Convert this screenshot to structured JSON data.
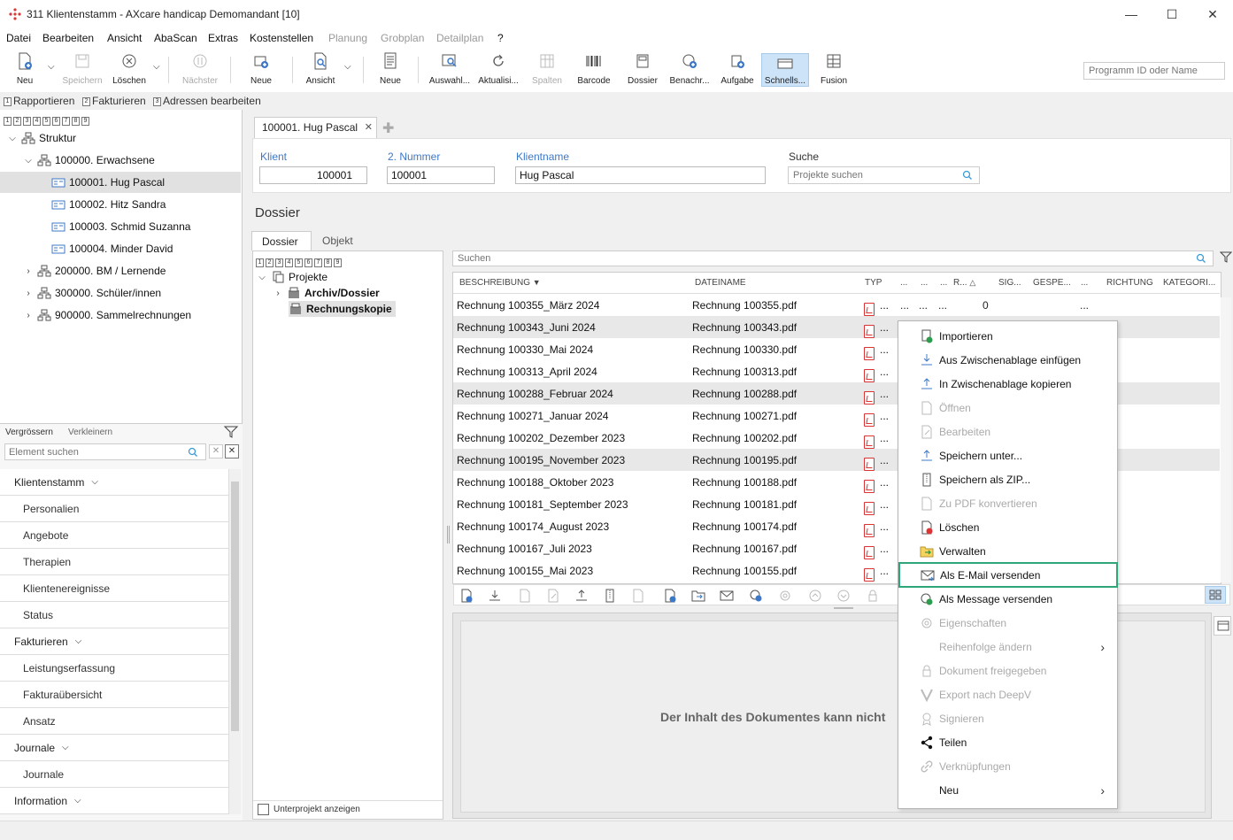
{
  "window": {
    "title": "311 Klientenstamm - AXcare handicap Demomandant [10]",
    "min": "—",
    "max": "☐",
    "close": "✕"
  },
  "menu": [
    {
      "label": "Datei",
      "enabled": true
    },
    {
      "label": "Bearbeiten",
      "enabled": true
    },
    {
      "label": "Ansicht",
      "enabled": true
    },
    {
      "label": "AbaScan",
      "enabled": true
    },
    {
      "label": "Extras",
      "enabled": true
    },
    {
      "label": "Kostenstellen",
      "enabled": true
    },
    {
      "label": "Planung",
      "enabled": false
    },
    {
      "label": "Grobplan",
      "enabled": false
    },
    {
      "label": "Detailplan",
      "enabled": false
    },
    {
      "label": "?",
      "enabled": true
    }
  ],
  "toolbar": {
    "neu": "Neu",
    "speichern": "Speichern",
    "loeschen": "Löschen",
    "naechster": "Nächster",
    "neue1": "Neue",
    "ansicht": "Ansicht",
    "neue2": "Neue",
    "auswahl": "Auswahl...",
    "aktualisieren": "Aktualisi...",
    "spalten": "Spalten",
    "barcode": "Barcode",
    "dossier": "Dossier",
    "benachrichtigung": "Benachr...",
    "aufgabe": "Aufgabe",
    "schnellsuche": "Schnells...",
    "fusion": "Fusion",
    "programm_id_placeholder": "Programm ID oder Name"
  },
  "quickbar": {
    "item1": "Rapportieren",
    "item2": "Fakturieren",
    "item3": "Adressen bearbeiten",
    "n1": "1",
    "n2": "2",
    "n3": "3"
  },
  "level_numbers": [
    "1",
    "2",
    "3",
    "4",
    "5",
    "6",
    "7",
    "8",
    "9"
  ],
  "tree": {
    "root": "Struktur",
    "items": [
      {
        "label": "100000. Erwachsene"
      },
      {
        "label": "100001. Hug Pascal"
      },
      {
        "label": "100002. Hitz Sandra"
      },
      {
        "label": "100003. Schmid Suzanna"
      },
      {
        "label": "100004. Minder David"
      },
      {
        "label": "200000. BM / Lernende"
      },
      {
        "label": "300000. Schüler/innen"
      },
      {
        "label": "900000. Sammelrechnungen"
      }
    ]
  },
  "navtools": {
    "vergroessern": "Vergrössern",
    "verkleinern": "Verkleinern",
    "search_placeholder": "Element suchen"
  },
  "nav": {
    "klientenstamm": "Klientenstamm",
    "personalien": "Personalien",
    "angebote": "Angebote",
    "therapien": "Therapien",
    "klientenereignisse": "Klientenereignisse",
    "status": "Status",
    "fakturieren": "Fakturieren",
    "leistungserfassung": "Leistungserfassung",
    "fakturauebersicht": "Fakturaübersicht",
    "ansatz": "Ansatz",
    "journale": "Journale",
    "journale_sub": "Journale",
    "information": "Information"
  },
  "tab": {
    "label": "100001. Hug Pascal"
  },
  "header": {
    "klient_label": "Klient",
    "klient_value": "100001",
    "nummer_label": "2. Nummer",
    "nummer_value": "100001",
    "name_label": "Klientname",
    "name_value": "Hug Pascal",
    "suche_label": "Suche",
    "suche_placeholder": "Projekte suchen"
  },
  "dossier": {
    "title": "Dossier",
    "tab_dossier": "Dossier",
    "tab_objekt": "Objekt",
    "projekte": "Projekte",
    "archiv": "Archiv/Dossier",
    "rechnungskopie": "Rechnungskopie",
    "unterprojekt": "Unterprojekt anzeigen",
    "search_placeholder": "Suchen",
    "preview_text": "Der Inhalt des Dokumentes kann nicht"
  },
  "grid": {
    "headers": {
      "beschreibung": "BESCHREIBUNG",
      "dateiname": "DATEINAME",
      "typ": "TYP",
      "d1": "...",
      "d2": "...",
      "d3": "...",
      "r": "R...",
      "sig": "SIG...",
      "gespe": "GESPE...",
      "d4": "...",
      "richtung": "RICHTUNG",
      "kategori": "KATEGORI..."
    },
    "first_row_extra": {
      "d1": "...",
      "d2": "...",
      "d3": "...",
      "r": "0",
      "d4": "..."
    },
    "rows": [
      {
        "beschreibung": "Rechnung 100355_März 2024",
        "dateiname": "Rechnung 100355.pdf",
        "typ": "..."
      },
      {
        "beschreibung": "Rechnung 100343_Juni 2024",
        "dateiname": "Rechnung 100343.pdf",
        "typ": "..."
      },
      {
        "beschreibung": "Rechnung 100330_Mai 2024",
        "dateiname": "Rechnung 100330.pdf",
        "typ": "..."
      },
      {
        "beschreibung": "Rechnung 100313_April 2024",
        "dateiname": "Rechnung 100313.pdf",
        "typ": "..."
      },
      {
        "beschreibung": "Rechnung 100288_Februar 2024",
        "dateiname": "Rechnung 100288.pdf",
        "typ": "..."
      },
      {
        "beschreibung": "Rechnung 100271_Januar 2024",
        "dateiname": "Rechnung 100271.pdf",
        "typ": "..."
      },
      {
        "beschreibung": "Rechnung 100202_Dezember 2023",
        "dateiname": "Rechnung 100202.pdf",
        "typ": "..."
      },
      {
        "beschreibung": "Rechnung 100195_November 2023",
        "dateiname": "Rechnung 100195.pdf",
        "typ": "..."
      },
      {
        "beschreibung": "Rechnung 100188_Oktober 2023",
        "dateiname": "Rechnung 100188.pdf",
        "typ": "..."
      },
      {
        "beschreibung": "Rechnung 100181_September 2023",
        "dateiname": "Rechnung 100181.pdf",
        "typ": "..."
      },
      {
        "beschreibung": "Rechnung 100174_August 2023",
        "dateiname": "Rechnung 100174.pdf",
        "typ": "..."
      },
      {
        "beschreibung": "Rechnung 100167_Juli 2023",
        "dateiname": "Rechnung 100167.pdf",
        "typ": "..."
      },
      {
        "beschreibung": "Rechnung 100155_Mai 2023",
        "dateiname": "Rechnung 100155.pdf",
        "typ": "..."
      }
    ]
  },
  "context_menu": [
    {
      "label": "Importieren",
      "icon": "import-icon",
      "enabled": true
    },
    {
      "label": "Aus Zwischenablage einfügen",
      "icon": "paste-icon",
      "enabled": true
    },
    {
      "label": "In Zwischenablage kopieren",
      "icon": "copy-icon",
      "enabled": true
    },
    {
      "label": "Öffnen",
      "icon": "open-icon",
      "enabled": false
    },
    {
      "label": "Bearbeiten",
      "icon": "edit-icon",
      "enabled": false
    },
    {
      "label": "Speichern unter...",
      "icon": "save-as-icon",
      "enabled": true
    },
    {
      "label": "Speichern als ZIP...",
      "icon": "zip-icon",
      "enabled": true
    },
    {
      "label": "Zu PDF konvertieren",
      "icon": "pdf-convert-icon",
      "enabled": false
    },
    {
      "label": "Löschen",
      "icon": "delete-icon",
      "enabled": true
    },
    {
      "label": "Verwalten",
      "icon": "manage-icon",
      "enabled": true
    },
    {
      "label": "Als E-Mail versenden",
      "icon": "email-icon",
      "enabled": true,
      "highlighted": true
    },
    {
      "label": "Als Message versenden",
      "icon": "message-icon",
      "enabled": true
    },
    {
      "label": "Eigenschaften",
      "icon": "properties-icon",
      "enabled": false
    },
    {
      "label": "Reihenfolge ändern",
      "icon": "",
      "enabled": false,
      "submenu": true
    },
    {
      "label": "Dokument freigegeben",
      "icon": "lock-icon",
      "enabled": false
    },
    {
      "label": "Export nach DeepV",
      "icon": "deepv-icon",
      "enabled": false
    },
    {
      "label": "Signieren",
      "icon": "sign-icon",
      "enabled": false
    },
    {
      "label": "Teilen",
      "icon": "share-icon",
      "enabled": true
    },
    {
      "label": "Verknüpfungen",
      "icon": "link-icon",
      "enabled": false
    },
    {
      "label": "Neu",
      "icon": "",
      "enabled": true,
      "submenu": true
    }
  ],
  "colors": {
    "accent": "#3d78c8",
    "highlight": "#2fa67a",
    "pdf": "#d33333"
  }
}
